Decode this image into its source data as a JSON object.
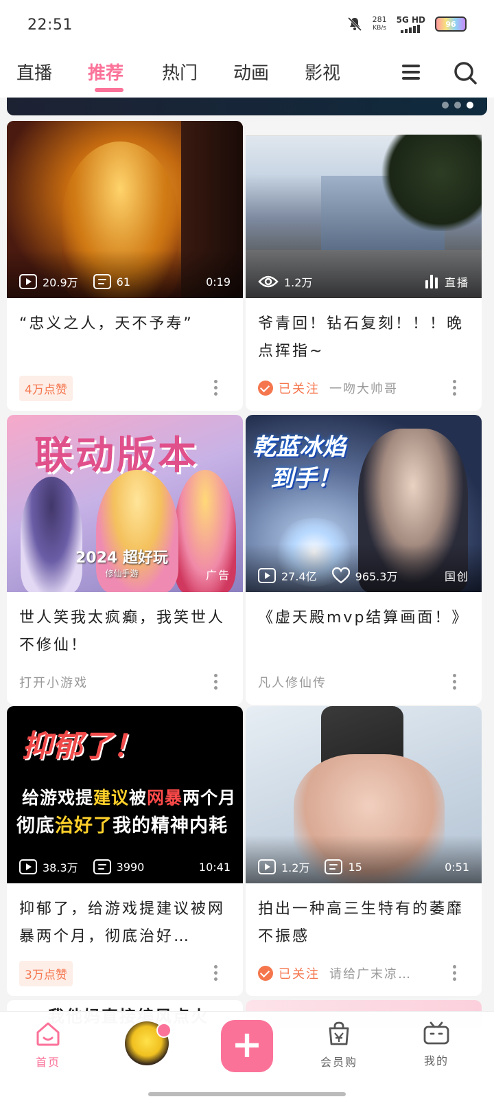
{
  "status_bar": {
    "time": "22:51",
    "speed_value": "281",
    "speed_unit": "KB/s",
    "network": "5G HD",
    "battery": "96"
  },
  "tabs": [
    {
      "label": "直播"
    },
    {
      "label": "推荐",
      "active": true
    },
    {
      "label": "热门"
    },
    {
      "label": "动画"
    },
    {
      "label": "影视"
    }
  ],
  "icons": {
    "menu": "hamburger-menu-icon",
    "search": "search-icon"
  },
  "feed": [
    {
      "title": "“忠义之人，天不予寿”",
      "views": "20.9万",
      "danmaku": "61",
      "duration": "0:19",
      "like_badge": "4万点赞"
    },
    {
      "title": "爷青回！钻石复刻！！！晚点挥指~",
      "views": "1.2万",
      "live_label": "直播",
      "followed_label": "已关注",
      "author": "一吻大帅哥"
    },
    {
      "title": "世人笑我太疯癫，我笑世人不修仙！",
      "ad_label": "广告",
      "source": "打开小游戏",
      "thumb_title": "联动版本",
      "thumb_emblem": "2024 超好玩",
      "thumb_emblem_sub": "修仙手游"
    },
    {
      "title": "《虚天殿mvp结算画面！》",
      "views": "27.4亿",
      "likes": "965.3万",
      "tag": "国创",
      "source": "凡人修仙传",
      "thumb_text_1": "乾蓝冰焰",
      "thumb_text_2": "到手！"
    },
    {
      "title": "抑郁了，给游戏提建议被网暴两个月，彻底治好…",
      "views": "38.3万",
      "danmaku": "3990",
      "duration": "10:41",
      "like_badge": "3万点赞",
      "thumb_line_1": "抑郁了！",
      "thumb_line_2": {
        "a": "给游戏提",
        "b": "建议",
        "c": "被",
        "d": "网暴",
        "e": "两个月"
      },
      "thumb_line_3": {
        "a": "彻底",
        "b": "治好了",
        "c": "我的精神内耗"
      }
    },
    {
      "title": "拍出一种高三生特有的萎靡不振感",
      "views": "1.2万",
      "danmaku": "15",
      "duration": "0:51",
      "followed_label": "已关注",
      "author": "请给广末凉…"
    }
  ],
  "peek": {
    "left_text": "我他妈直接编风点火"
  },
  "bottom_nav": {
    "home": "首页",
    "shop": "会员购",
    "mine": "我的",
    "publish": "+"
  },
  "colors": {
    "accent": "#fb7299",
    "followed": "#f5764d"
  }
}
